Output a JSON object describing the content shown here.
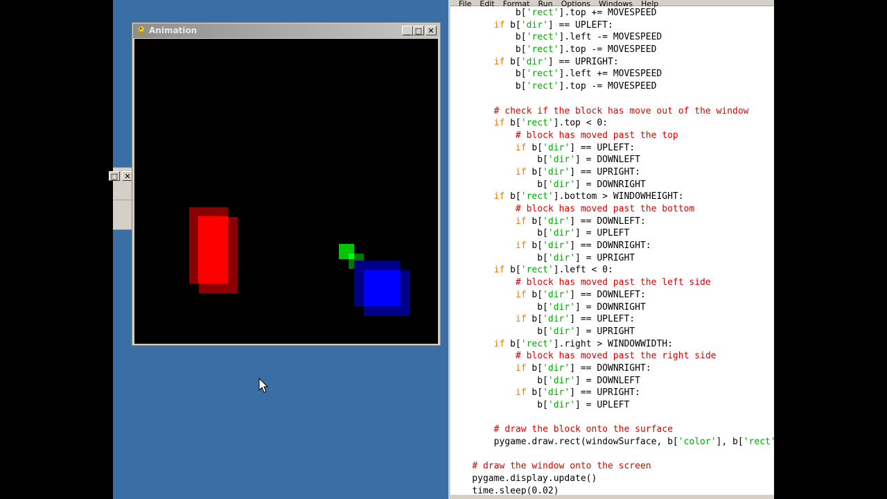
{
  "animation_window": {
    "title": "Animation",
    "buttons": {
      "minimize": "_",
      "maximize": "□",
      "close": "✕"
    },
    "colors": {
      "red": "#ff0000",
      "dark_red": "#880000",
      "green": "#00c800",
      "dark_green": "#007800",
      "blue": "#0000ff",
      "dark_blue": "#000088"
    }
  },
  "editor": {
    "menu": [
      "File",
      "Edit",
      "Format",
      "Run",
      "Options",
      "Windows",
      "Help"
    ],
    "lines": [
      "            b['rect'].top += MOVESPEED",
      "        if b['dir'] == UPLEFT:",
      "            b['rect'].left -= MOVESPEED",
      "            b['rect'].top -= MOVESPEED",
      "        if b['dir'] == UPRIGHT:",
      "            b['rect'].left += MOVESPEED",
      "            b['rect'].top -= MOVESPEED",
      "",
      "        # check if the block has move out of the window",
      "        if b['rect'].top < 0:",
      "            # block has moved past the top",
      "            if b['dir'] == UPLEFT:",
      "                b['dir'] = DOWNLEFT",
      "            if b['dir'] == UPRIGHT:",
      "                b['dir'] = DOWNRIGHT",
      "        if b['rect'].bottom > WINDOWHEIGHT:",
      "            # block has moved past the bottom",
      "            if b['dir'] == DOWNLEFT:",
      "                b['dir'] = UPLEFT",
      "            if b['dir'] == DOWNRIGHT:",
      "                b['dir'] = UPRIGHT",
      "        if b['rect'].left < 0:",
      "            # block has moved past the left side",
      "            if b['dir'] == DOWNLEFT:",
      "                b['dir'] = DOWNRIGHT",
      "            if b['dir'] == UPLEFT:",
      "                b['dir'] = UPRIGHT",
      "        if b['rect'].right > WINDOWWIDTH:",
      "            # block has moved past the right side",
      "            if b['dir'] == DOWNRIGHT:",
      "                b['dir'] = DOWNLEFT",
      "            if b['dir'] == UPRIGHT:",
      "                b['dir'] = UPLEFT",
      "",
      "        # draw the block onto the surface",
      "        pygame.draw.rect(windowSurface, b['color'], b['rect'])",
      "",
      "    # draw the window onto the screen",
      "    pygame.display.update()",
      "    time.sleep(0.02)"
    ]
  }
}
